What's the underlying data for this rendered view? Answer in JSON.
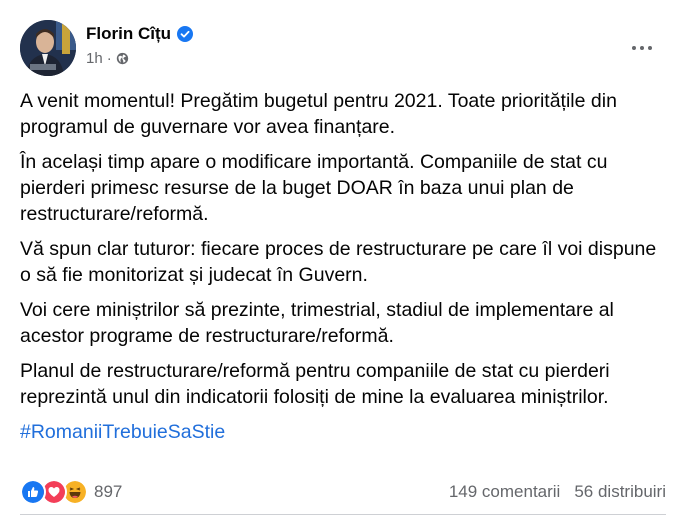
{
  "author": {
    "name": "Florin Cîțu",
    "time": "1h",
    "separator": "·"
  },
  "post": {
    "paragraphs": [
      "A venit momentul! Pregătim bugetul pentru 2021. Toate prioritățile din programul de guvernare vor avea finanțare.",
      "În același timp apare o modificare importantă. Companiile de stat cu pierderi primesc resurse de la buget DOAR în baza unui plan de restructurare/reformă.",
      "Vă spun clar tuturor: fiecare proces de restructurare pe care îl voi dispune o să fie monitorizat și judecat în Guvern.",
      "Voi cere miniștrilor să prezinte, trimestrial, stadiul de implementare al acestor programe de restructurare/reformă.",
      "Planul de restructurare/reformă pentru companiile de stat cu pierderi reprezintă unul din indicatorii folosiți de mine la evaluarea miniștrilor."
    ],
    "hashtag": "#RomaniiTrebuieSaStie"
  },
  "engagement": {
    "reaction_count": "897",
    "comments": "149 comentarii",
    "shares": "56 distribuiri",
    "reaction_icons": [
      "like-icon",
      "love-icon",
      "haha-icon"
    ]
  },
  "colors": {
    "link": "#216fdb",
    "secondary_text": "#65676b",
    "verified": "#1877f2",
    "like": "#1877f2",
    "love": "#f33e58",
    "haha": "#f7b125"
  }
}
